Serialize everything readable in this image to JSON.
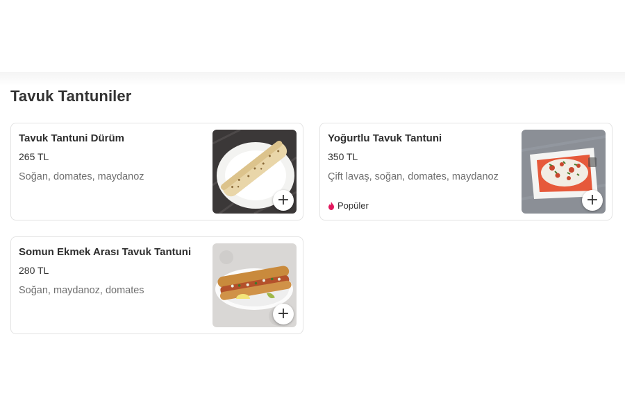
{
  "section": {
    "title": "Tavuk Tantuniler"
  },
  "products": [
    {
      "name": "Tavuk Tantuni Dürüm",
      "price": "265 TL",
      "description": "Soğan, domates, maydanoz",
      "badge": ""
    },
    {
      "name": "Yoğurtlu Tavuk Tantuni",
      "price": "350 TL",
      "description": "Çift lavaş, soğan, domates, maydanoz",
      "badge": "Popüler"
    },
    {
      "name": "Somun Ekmek Arası Tavuk Tantuni",
      "price": "280 TL",
      "description": "Soğan, maydanoz, domates",
      "badge": ""
    }
  ],
  "add_button_icon": "plus-icon",
  "badge_icon": "flame-icon",
  "colors": {
    "badge_icon": "#e2175d",
    "card_border": "#e3e3e3",
    "description_text": "#6f6f6f"
  }
}
